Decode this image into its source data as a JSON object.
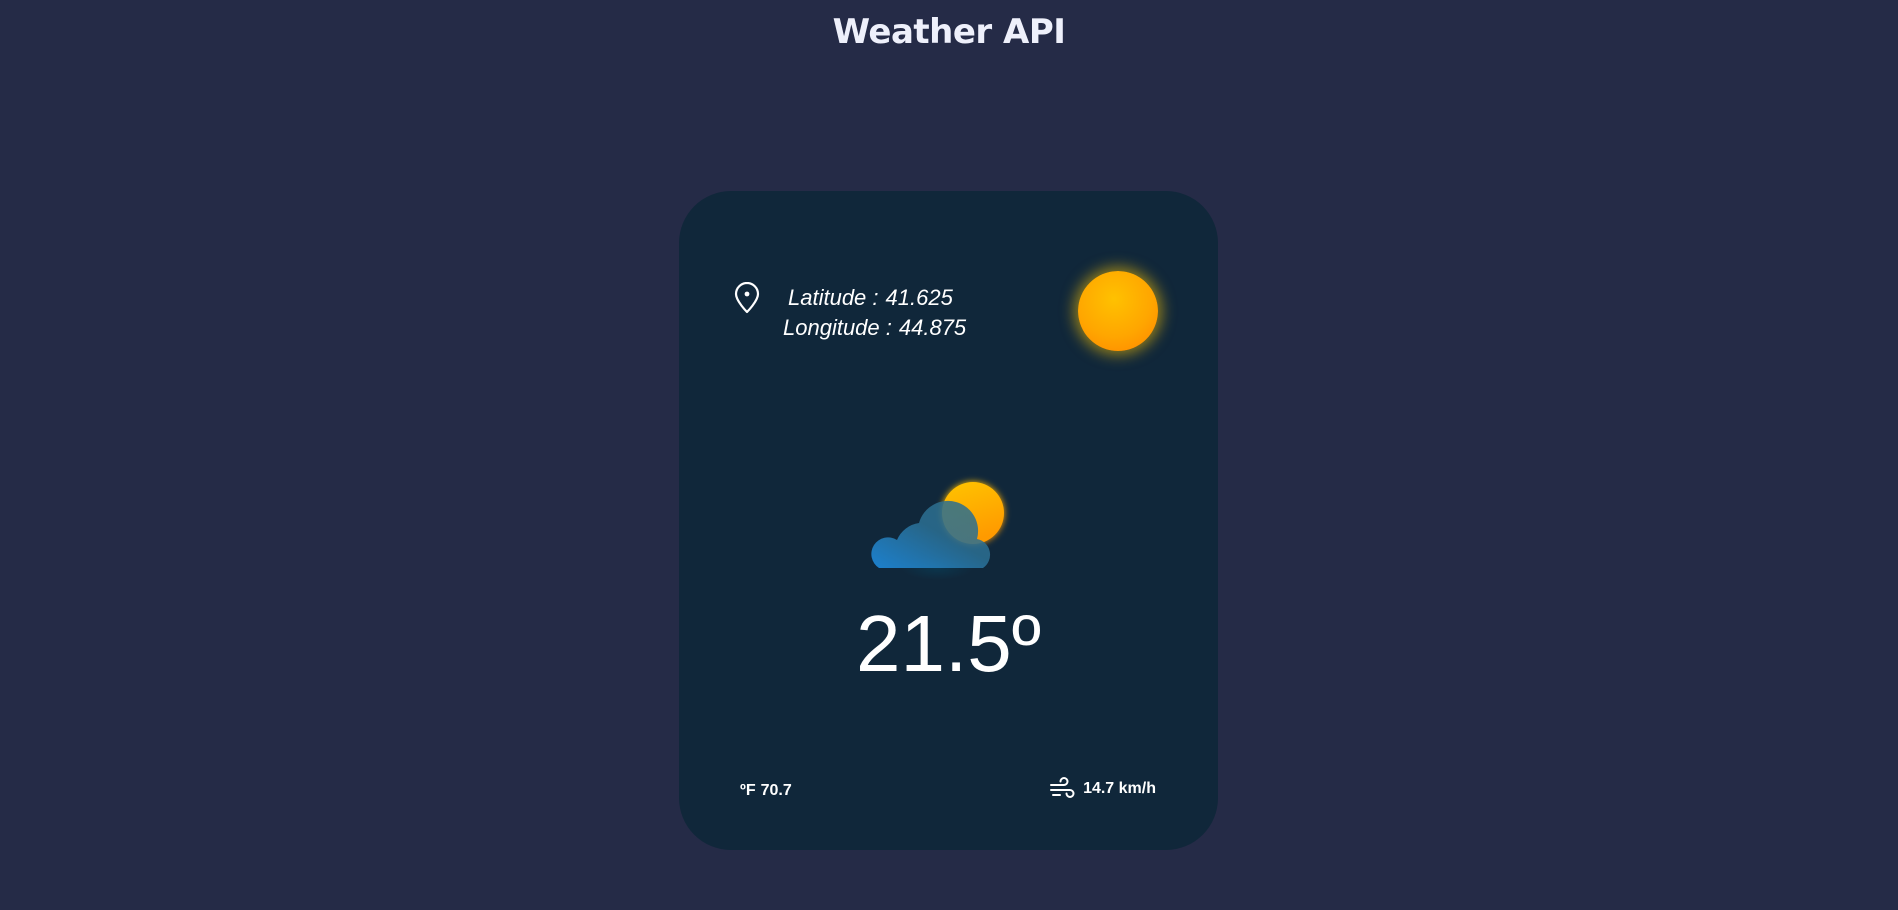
{
  "page": {
    "title": "Weather API"
  },
  "location": {
    "latitude_label": "Latitude :",
    "latitude_value": "41.625",
    "longitude_label": "Longitude :",
    "longitude_value": "44.875"
  },
  "weather": {
    "temperature": "21.5º",
    "condition_icon": "partly-cloudy-icon",
    "daylight_icon": "sun-icon"
  },
  "footer": {
    "fahrenheit_unit": "ºF",
    "fahrenheit_value": "70.7",
    "wind_speed": "14.7 km/h",
    "wind_icon": "wind-icon"
  },
  "colors": {
    "background": "#252b47",
    "card": "#10273a",
    "sun": "#ffa600",
    "cloud": "#2196e8"
  }
}
